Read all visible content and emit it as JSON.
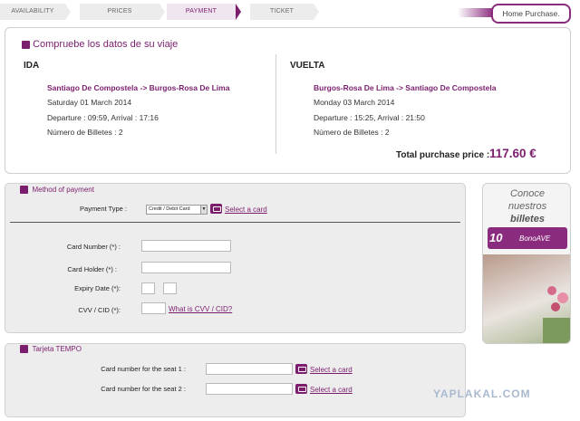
{
  "steps": [
    "AVAILABILITY",
    "PRICES",
    "PAYMENT",
    "TICKET"
  ],
  "home_button": "Home Purchase.",
  "summary": {
    "title": "Compruebe los datos de su viaje",
    "outbound": {
      "heading": "IDA",
      "route": "Santiago De Compostela -> Burgos-Rosa De Lima",
      "date": "Saturday 01 March 2014",
      "times": "Departure : 09:59, Arrival : 17:16",
      "tickets": "Número de Billetes : 2"
    },
    "return": {
      "heading": "VUELTA",
      "route": "Burgos-Rosa De Lima -> Santiago De Compostela",
      "date": "Monday 03 March 2014",
      "times": "Departure : 15:25, Arrival : 21:50",
      "tickets": "Número de Billetes : 2"
    },
    "total_label": "Total purchase price :",
    "total_value": "117.60 €"
  },
  "payment": {
    "title": "Method of payment",
    "type_label": "Payment Type :",
    "type_value": "Credit / Debit Card",
    "select_card": "Select a card",
    "card_number_label": "Card Number (*) :",
    "card_holder_label": "Card Holder (*) :",
    "expiry_label": "Expiry Date (*):",
    "cvv_label": "CVV / CID (*):",
    "cvv_link": "What is CVV / CID?"
  },
  "tempo": {
    "title": "Tarjeta TEMPO",
    "seat1_label": "Card number for the seat 1 :",
    "seat2_label": "Card number for the seat 2 :",
    "select_card": "Select a card"
  },
  "ad": {
    "line1": "Conoce",
    "line2": "nuestros",
    "line3": "billetes",
    "logo_number": "10",
    "logo_text": "BonoAVE"
  },
  "watermark": "YAPLAKAL.COM",
  "colors": {
    "accent": "#7b1e6e",
    "panel_gray": "#ededed"
  }
}
